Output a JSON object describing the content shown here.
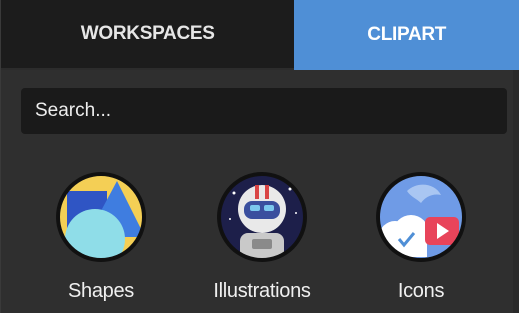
{
  "tabs": [
    {
      "label": "WORKSPACES",
      "active": false
    },
    {
      "label": "CLIPART",
      "active": true
    }
  ],
  "search": {
    "placeholder": "Search...",
    "value": ""
  },
  "categories": [
    {
      "label": "Shapes",
      "icon": "shapes-icon"
    },
    {
      "label": "Illustrations",
      "icon": "astronaut-icon"
    },
    {
      "label": "Icons",
      "icon": "icons-collage-icon"
    }
  ],
  "colors": {
    "accent": "#4f8fd6",
    "panel_bg": "#2f2f2f",
    "inactive_tab_bg": "#1c1c1c",
    "search_bg": "#1a1a1a"
  }
}
